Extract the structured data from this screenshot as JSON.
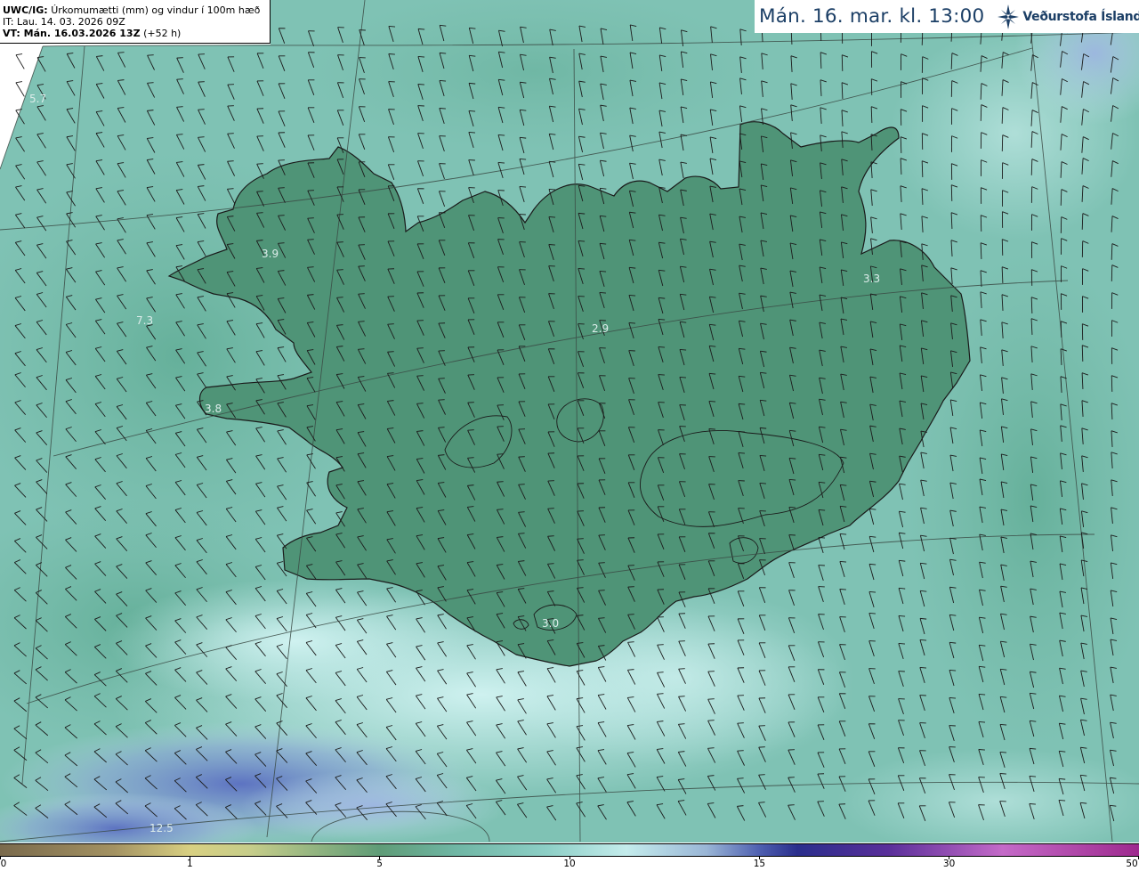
{
  "info": {
    "model": "UWC/IG:",
    "description": "Úrkomumætti (mm) og vindur í 100m hæð",
    "it": "IT: Lau. 14. 03. 2026 09Z",
    "vt_label": "VT: Mán. 16.03.2026 13Z",
    "vt_offset": "(+52 h)"
  },
  "datetime": "Mán. 16. mar. kl. 13:00",
  "brand": {
    "name": "Veðurstofa Íslands",
    "icon": "vedurstofa-logo-icon"
  },
  "colorbar": {
    "ticks": [
      {
        "label": "0",
        "pos": 0.0
      },
      {
        "label": "1",
        "pos": 0.1667
      },
      {
        "label": "5",
        "pos": 0.3333
      },
      {
        "label": "10",
        "pos": 0.5
      },
      {
        "label": "15",
        "pos": 0.6667
      },
      {
        "label": "30",
        "pos": 0.8333
      },
      {
        "label": "50",
        "pos": 1.0
      }
    ]
  },
  "stations": [
    {
      "name": "station-value",
      "value": "5.7"
    },
    {
      "name": "station-value",
      "value": "3.9"
    },
    {
      "name": "station-value",
      "value": "7.3"
    },
    {
      "name": "station-value",
      "value": "3.8"
    },
    {
      "name": "station-value",
      "value": "2.9"
    },
    {
      "name": "station-value",
      "value": "3.3"
    },
    {
      "name": "station-value",
      "value": "3.0"
    },
    {
      "name": "station-value",
      "value": "12.5"
    }
  ],
  "colors": {
    "sea": "#7fc2b4",
    "lowland": "#4f9477",
    "highland": "#d6d487",
    "calm": "#c8eeee",
    "heavy": "#5f72c4",
    "coast": "#1a1a1a",
    "title": "#1c3f66"
  }
}
